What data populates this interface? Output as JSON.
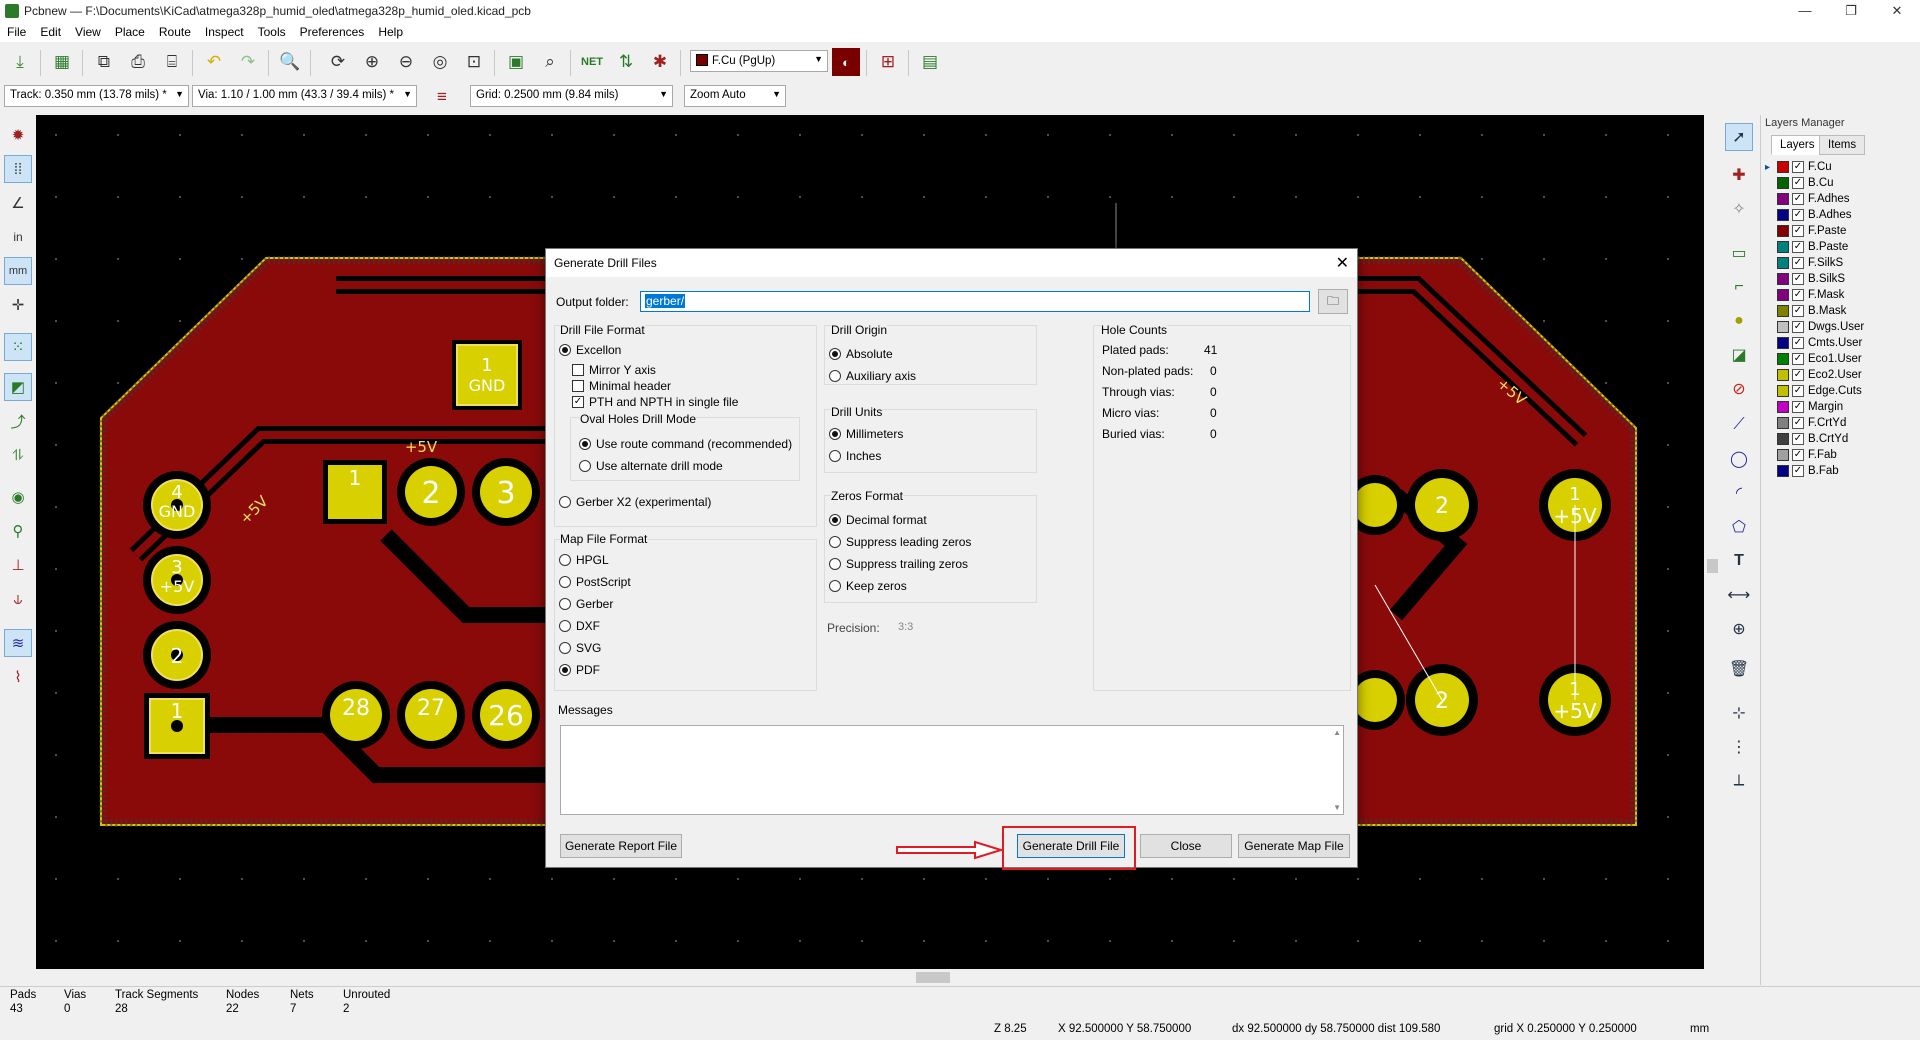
{
  "window": {
    "title": "Pcbnew — F:\\Documents\\KiCad\\atmega328p_humid_oled\\atmega328p_humid_oled.kicad_pcb",
    "min": "—",
    "max": "❐",
    "close": "✕"
  },
  "menu": [
    "File",
    "Edit",
    "View",
    "Place",
    "Route",
    "Inspect",
    "Tools",
    "Preferences",
    "Help"
  ],
  "toolbar": {
    "layer_select": "F.Cu (PgUp)",
    "track_width": "Track: 0.350 mm (13.78 mils) *",
    "via_size": "Via: 1.10 / 1.00 mm (43.3 / 39.4 mils) *",
    "grid": "Grid: 0.2500 mm (9.84 mils)",
    "zoom": "Zoom Auto",
    "layer_color": "#7a0000"
  },
  "left_toolbar": [
    "drc-icon",
    "grid-icon",
    "polar-icon",
    "inch-icon",
    "mm-icon",
    "cursor-icon",
    "ratsnest-icon",
    "zone-icon",
    "track-icon",
    "via-icon",
    "microwave-icon",
    "layers-icon",
    "hv-icon",
    "contrast-icon",
    "wave-icon"
  ],
  "layers_manager": {
    "title": "Layers Manager",
    "tabs": [
      "Layers",
      "Items"
    ],
    "items": [
      {
        "name": "F.Cu",
        "color": "#c80000"
      },
      {
        "name": "B.Cu",
        "color": "#006400"
      },
      {
        "name": "F.Adhes",
        "color": "#800080"
      },
      {
        "name": "B.Adhes",
        "color": "#000080"
      },
      {
        "name": "F.Paste",
        "color": "#800000"
      },
      {
        "name": "B.Paste",
        "color": "#008080"
      },
      {
        "name": "F.SilkS",
        "color": "#008080"
      },
      {
        "name": "B.SilkS",
        "color": "#800080"
      },
      {
        "name": "F.Mask",
        "color": "#800080"
      },
      {
        "name": "B.Mask",
        "color": "#808000"
      },
      {
        "name": "Dwgs.User",
        "color": "#c0c0c0"
      },
      {
        "name": "Cmts.User",
        "color": "#000080"
      },
      {
        "name": "Eco1.User",
        "color": "#008000"
      },
      {
        "name": "Eco2.User",
        "color": "#c0c000"
      },
      {
        "name": "Edge.Cuts",
        "color": "#c0c000"
      },
      {
        "name": "Margin",
        "color": "#c000c0"
      },
      {
        "name": "F.CrtYd",
        "color": "#808080"
      },
      {
        "name": "B.CrtYd",
        "color": "#404040"
      },
      {
        "name": "F.Fab",
        "color": "#a0a0a0"
      },
      {
        "name": "B.Fab",
        "color": "#000080"
      }
    ]
  },
  "pcb_labels": {
    "gnd": "GND",
    "p5v": "+5V",
    "n1": "1",
    "n2": "2",
    "n3": "3",
    "n4": "4",
    "n26": "26",
    "n27": "27",
    "n28": "28"
  },
  "dialog": {
    "title": "Generate Drill Files",
    "output_folder_label": "Output folder:",
    "output_folder_value": "gerber/",
    "drill_format": {
      "label": "Drill File Format",
      "excellon": "Excellon",
      "mirror_y": "Mirror Y axis",
      "minimal_header": "Minimal header",
      "pth_npth": "PTH and NPTH in single file",
      "oval_label": "Oval Holes Drill Mode",
      "route_cmd": "Use route command (recommended)",
      "alt_drill": "Use alternate drill mode",
      "gerber_x2": "Gerber X2 (experimental)"
    },
    "map_format": {
      "label": "Map File Format",
      "options": [
        "HPGL",
        "PostScript",
        "Gerber",
        "DXF",
        "SVG",
        "PDF"
      ],
      "selected": "PDF"
    },
    "drill_origin": {
      "label": "Drill Origin",
      "absolute": "Absolute",
      "aux": "Auxiliary axis"
    },
    "drill_units": {
      "label": "Drill Units",
      "mm": "Millimeters",
      "inch": "Inches"
    },
    "zeros_format": {
      "label": "Zeros Format",
      "decimal": "Decimal format",
      "leading": "Suppress leading zeros",
      "trailing": "Suppress trailing zeros",
      "keep": "Keep zeros"
    },
    "precision_label": "Precision:",
    "precision_value": "3:3",
    "hole_counts": {
      "label": "Hole Counts",
      "plated_label": "Plated pads:",
      "plated_value": "41",
      "nonplated_label": "Non-plated pads:",
      "nonplated_value": "0",
      "through_label": "Through vias:",
      "through_value": "0",
      "micro_label": "Micro vias:",
      "micro_value": "0",
      "buried_label": "Buried vias:",
      "buried_value": "0"
    },
    "messages_label": "Messages",
    "buttons": {
      "report": "Generate Report File",
      "drill": "Generate Drill File",
      "close": "Close",
      "map": "Generate Map File"
    }
  },
  "status": {
    "pads_label": "Pads",
    "pads_value": "43",
    "vias_label": "Vias",
    "vias_value": "0",
    "tracks_label": "Track Segments",
    "tracks_value": "28",
    "nodes_label": "Nodes",
    "nodes_value": "22",
    "nets_label": "Nets",
    "nets_value": "7",
    "unrouted_label": "Unrouted",
    "unrouted_value": "2",
    "zoom": "Z 8.25",
    "xy": "X 92.500000  Y 58.750000",
    "dxy": "dx 92.500000  dy 58.750000  dist 109.580",
    "grid": "grid X 0.250000  Y 0.250000",
    "units": "mm"
  }
}
